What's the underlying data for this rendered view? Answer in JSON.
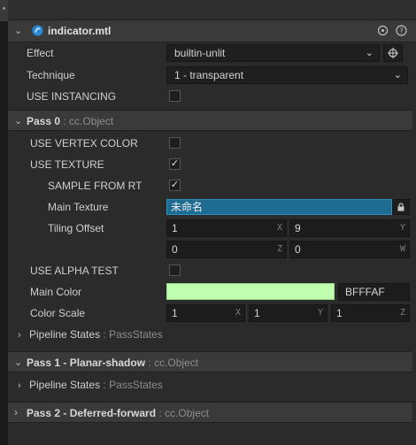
{
  "header": {
    "title": "indicator.mtl",
    "icons": [
      "collapse-chevron-icon",
      "material-asset-icon",
      "crosshair-locate-icon",
      "help-icon"
    ]
  },
  "effect": {
    "label": "Effect",
    "value": "builtin-unlit"
  },
  "technique": {
    "label": "Technique",
    "value": "1 - transparent"
  },
  "use_instancing": {
    "label": "USE INSTANCING",
    "checked": false
  },
  "pass0": {
    "title": "Pass 0",
    "type": ": cc.Object",
    "use_vertex_color": {
      "label": "USE VERTEX COLOR",
      "checked": false
    },
    "use_texture": {
      "label": "USE TEXTURE",
      "checked": true
    },
    "sample_from_rt": {
      "label": "SAMPLE FROM RT",
      "checked": true
    },
    "main_texture": {
      "label": "Main Texture",
      "value": "未命名"
    },
    "tiling_offset": {
      "label": "Tiling Offset",
      "x": "1",
      "y": "9",
      "z": "0",
      "w": "0",
      "axis_x": "X",
      "axis_y": "Y",
      "axis_z": "Z",
      "axis_w": "W"
    },
    "use_alpha_test": {
      "label": "USE ALPHA TEST",
      "checked": false
    },
    "main_color": {
      "label": "Main Color",
      "hex": "BFFFAF",
      "swatch": "#BFFFAF"
    },
    "color_scale": {
      "label": "Color Scale",
      "x": "1",
      "y": "1",
      "z": "1",
      "axis_x": "X",
      "axis_y": "Y",
      "axis_z": "Z"
    },
    "pipeline_states": {
      "label": "Pipeline States",
      "type": ": PassStates"
    }
  },
  "pass1": {
    "title": "Pass 1 - Planar-shadow",
    "type": ": cc.Object",
    "pipeline_states": {
      "label": "Pipeline States",
      "type": ": PassStates"
    }
  },
  "pass2": {
    "title": "Pass 2 - Deferred-forward",
    "type": ": cc.Object"
  },
  "colors": {
    "background": "#2b2b2b",
    "header": "#3a3a3a",
    "field": "#1f1f1f",
    "selection": "#1f6c93",
    "accent_icon": "#2b8ad6"
  }
}
